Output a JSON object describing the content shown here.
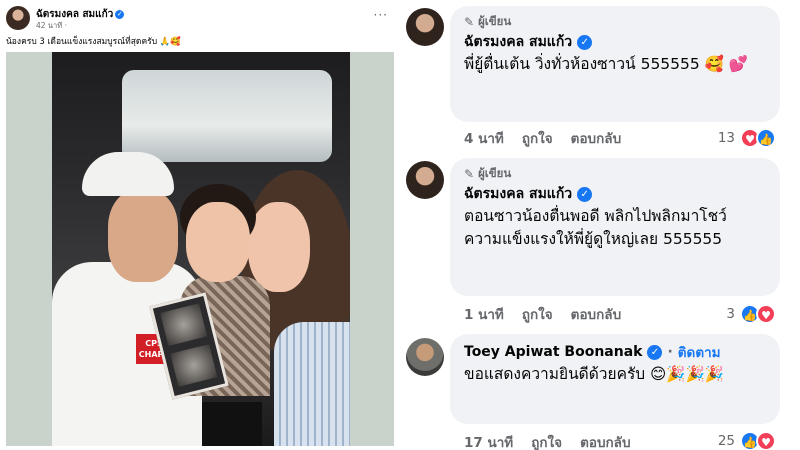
{
  "post": {
    "author": "ฉัตรมงคล สมแก้ว",
    "meta": "42 นาที · ",
    "caption": "น้องครบ 3 เดือนแข็งแรงสมบูรณ์ที่สุดครับ 🙏🥰",
    "more": "···",
    "photo_text": "CPS\nCHAPS"
  },
  "comments": [
    {
      "badge": "ผู้เขียน",
      "name": "ฉัตรมงคล สมแก้ว",
      "text": "พี่ยู้ตื่นเต้น วิ่งทั่วห้องซาวน์ 555555 🥰 💕",
      "time": "4 นาที",
      "like": "ถูกใจ",
      "reply": "ตอบกลับ",
      "reaction_count": "13"
    },
    {
      "badge": "ผู้เขียน",
      "name": "ฉัตรมงคล สมแก้ว",
      "text": "ตอนซาวน้องตื่นพอดี พลิกไปพลิกมาโชว์ความแข็งแรงให้พี่ยู้ดูใหญ่เลย 555555",
      "time": "1 นาที",
      "like": "ถูกใจ",
      "reply": "ตอบกลับ",
      "reaction_count": "3"
    },
    {
      "name": "Toey Apiwat Boonanak",
      "follow": "ติดตาม",
      "text": "ขอแสดงความยินดีด้วยครับ 😊🎉🎉🎉",
      "time": "17 นาที",
      "like": "ถูกใจ",
      "reply": "ตอบกลับ",
      "reaction_count": "25"
    }
  ],
  "colors": {
    "accent": "#1877f2",
    "love": "#f33e58",
    "bubble": "#f0f2f5",
    "muted": "#65676b"
  },
  "icons": {
    "verified": "verified-check-icon",
    "author_badge": "pencil-icon",
    "like": "like-thumb-icon",
    "love": "love-heart-icon"
  }
}
